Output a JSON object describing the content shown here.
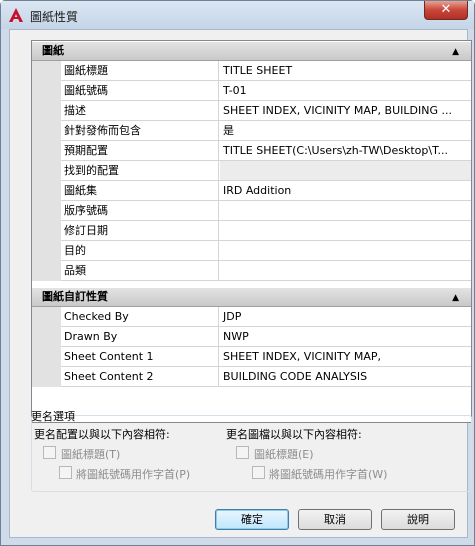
{
  "window": {
    "title": "圖紙性質",
    "close_symbol": "✕"
  },
  "sections": [
    {
      "header": "圖紙",
      "collapse_symbol": "▲",
      "rows": [
        {
          "name": "圖紙標題",
          "value": "TITLE SHEET"
        },
        {
          "name": "圖紙號碼",
          "value": "T-01"
        },
        {
          "name": "描述",
          "value": "SHEET INDEX, VICINITY MAP, BUILDING ..."
        },
        {
          "name": "針對發佈而包含",
          "value": "是"
        },
        {
          "name": "預期配置",
          "value": "TITLE SHEET(C:\\Users\\zh-TW\\Desktop\\T..."
        },
        {
          "name": "找到的配置",
          "value": ""
        },
        {
          "name": "圖紙集",
          "value": "IRD Addition"
        },
        {
          "name": "版序號碼",
          "value": ""
        },
        {
          "name": "修訂日期",
          "value": ""
        },
        {
          "name": "目的",
          "value": ""
        },
        {
          "name": "品類",
          "value": ""
        }
      ]
    },
    {
      "header": "圖紙自訂性質",
      "collapse_symbol": "▲",
      "rows": [
        {
          "name": "Checked By",
          "value": "JDP"
        },
        {
          "name": "Drawn By",
          "value": "NWP"
        },
        {
          "name": "Sheet Content 1",
          "value": "SHEET INDEX, VICINITY MAP,"
        },
        {
          "name": "Sheet Content 2",
          "value": "BUILDING CODE ANALYSIS"
        }
      ]
    }
  ],
  "rename_options": {
    "title": "更名選項",
    "left": {
      "heading": "更名配置以與以下內容相符:",
      "checkbox1": "圖紙標題(T)",
      "checkbox2": "將圖紙號碼用作字首(P)"
    },
    "right": {
      "heading": "更名圖檔以與以下內容相符:",
      "checkbox1": "圖紙標題(E)",
      "checkbox2": "將圖紙號碼用作字首(W)"
    }
  },
  "buttons": {
    "ok": "確定",
    "cancel": "取消",
    "help": "說明"
  },
  "colors": {
    "app_icon": "#c8102e",
    "close_button": "#c7473a"
  },
  "icons": {
    "app": "autocad-a-icon",
    "close": "close-icon"
  }
}
